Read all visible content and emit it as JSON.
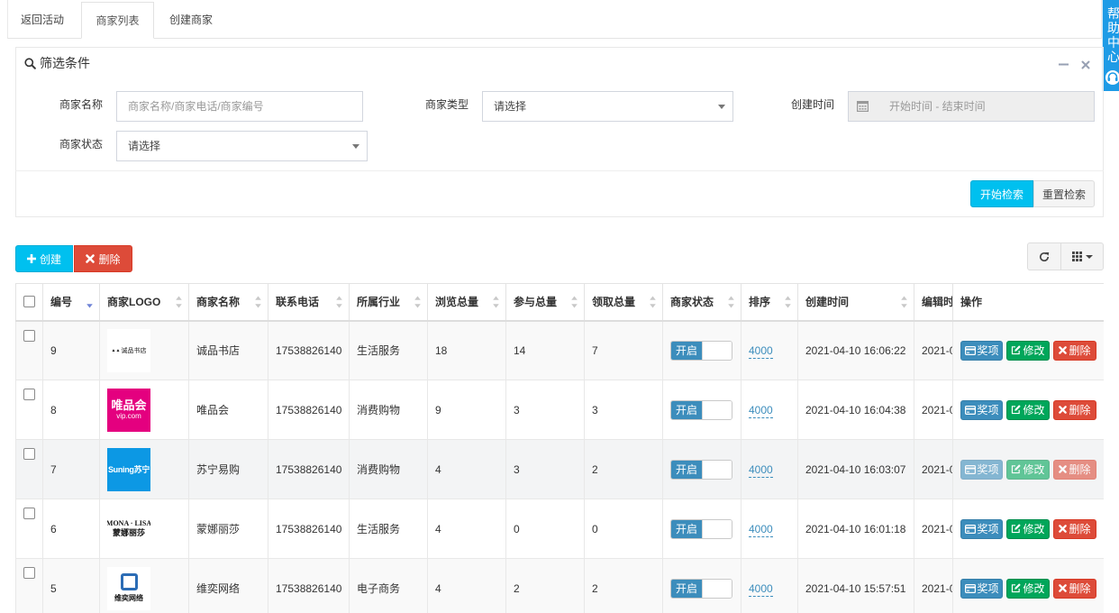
{
  "colors": {
    "info": "#00c0ef",
    "primary": "#3c8dbc",
    "success": "#00a65a",
    "danger": "#dd4b39",
    "help_widget": "#1e9be6",
    "sort_active": "#6f83d6"
  },
  "tabs": [
    {
      "label": "返回活动",
      "active": false
    },
    {
      "label": "商家列表",
      "active": true
    },
    {
      "label": "创建商家",
      "active": false
    }
  ],
  "help_widget": {
    "label": "帮助中心",
    "icon": "headset-icon"
  },
  "filter": {
    "title": "筛选条件",
    "icons": [
      "search-icon",
      "minus-icon",
      "close-icon",
      "calendar-icon"
    ],
    "name_label": "商家名称",
    "name_placeholder": "商家名称/商家电话/商家编号",
    "type_label": "商家类型",
    "type_value": "请选择",
    "time_label": "创建时间",
    "time_placeholder": "开始时间 - 结束时间",
    "status_label": "商家状态",
    "status_value": "请选择",
    "search_button": "开始检索",
    "reset_button": "重置检索"
  },
  "toolbar": {
    "create_label": "创建",
    "delete_label": "删除",
    "icons": [
      "plus-icon",
      "times-icon",
      "refresh-icon",
      "columns-grid-icon"
    ]
  },
  "table": {
    "columns": [
      "编号",
      "商家LOGO",
      "商家名称",
      "联系电话",
      "所属行业",
      "浏览总量",
      "参与总量",
      "领取总量",
      "商家状态",
      "排序",
      "创建时间",
      "编辑时",
      "操作"
    ],
    "sort_column_index": 0,
    "sort_icon": "sort-desc-icon",
    "actions": [
      "奖项",
      "修改",
      "删除"
    ],
    "action_icons": [
      "credit-card-icon",
      "edit-icon",
      "times-icon"
    ],
    "rows": [
      {
        "id": 9,
        "logo": {
          "name": "eslite-logo",
          "bg": "#ffffff",
          "color": "#222222",
          "lines": [
            "诚品书店"
          ]
        },
        "name": "诚品书店",
        "phone": "17538826140",
        "industry": "生活服务",
        "views": 18,
        "joins": 14,
        "claims": 7,
        "status": "开启",
        "sort": "4000",
        "created": "2021-04-10 16:06:22",
        "edited": "2021-0"
      },
      {
        "id": 8,
        "logo": {
          "name": "vip-logo",
          "bg": "#e4007f",
          "color": "#ffffff",
          "lines": [
            "唯品会",
            "vip.com"
          ]
        },
        "name": "唯品会",
        "phone": "17538826140",
        "industry": "消费购物",
        "views": 9,
        "joins": 3,
        "claims": 3,
        "status": "开启",
        "sort": "4000",
        "created": "2021-04-10 16:04:38",
        "edited": "2021-0"
      },
      {
        "id": 7,
        "logo": {
          "name": "suning-logo",
          "bg": "#0c98e4",
          "color": "#ffffff",
          "lines": [
            "Suning苏宁"
          ]
        },
        "name": "苏宁易购",
        "phone": "17538826140",
        "industry": "消费购物",
        "views": 4,
        "joins": 3,
        "claims": 2,
        "status": "开启",
        "sort": "4000",
        "created": "2021-04-10 16:03:07",
        "edited": "2021-0"
      },
      {
        "id": 6,
        "logo": {
          "name": "monalisa-logo",
          "bg": "#ffffff",
          "color": "#111111",
          "lines": [
            "MONA · LISA",
            "蒙娜丽莎"
          ]
        },
        "name": "蒙娜丽莎",
        "phone": "17538826140",
        "industry": "生活服务",
        "views": 4,
        "joins": 0,
        "claims": 0,
        "status": "开启",
        "sort": "4000",
        "created": "2021-04-10 16:01:18",
        "edited": "2021-0"
      },
      {
        "id": 5,
        "logo": {
          "name": "weiyi-logo",
          "bg": "#ffffff",
          "color": "#111111",
          "lines": [
            "维奕网络"
          ]
        },
        "name": "维奕网络",
        "phone": "17538826140",
        "industry": "电子商务",
        "views": 4,
        "joins": 2,
        "claims": 2,
        "status": "开启",
        "sort": "4000",
        "created": "2021-04-10 15:57:51",
        "edited": "2021-0"
      }
    ]
  }
}
